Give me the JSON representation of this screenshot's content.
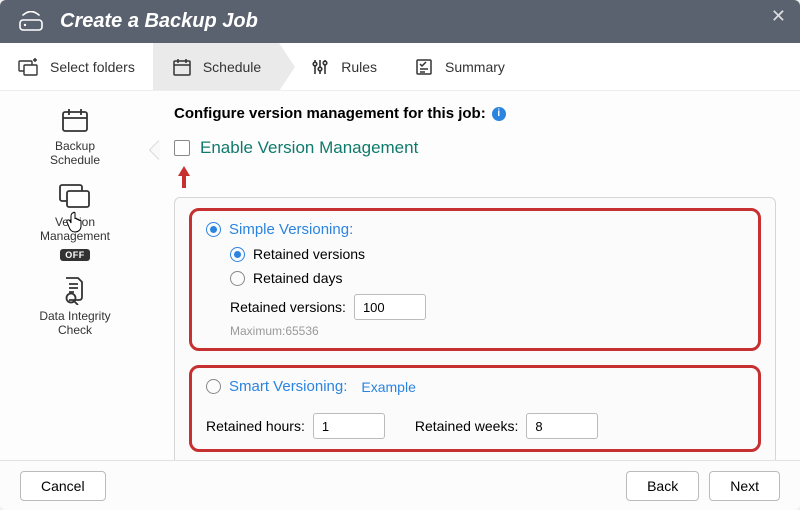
{
  "header": {
    "title": "Create a Backup Job"
  },
  "steps": {
    "select_folders": "Select folders",
    "schedule": "Schedule",
    "rules": "Rules",
    "summary": "Summary"
  },
  "sidebar": {
    "backup_schedule": "Backup\nSchedule",
    "version_mgmt": "Version\nManagement",
    "off_badge": "OFF",
    "integrity": "Data Integrity\nCheck"
  },
  "main": {
    "heading": "Configure version management for this job:",
    "enable_label": "Enable Version Management",
    "simple": {
      "title": "Simple Versioning:",
      "opt_versions": "Retained versions",
      "opt_days": "Retained days",
      "field_label": "Retained versions:",
      "value": "100",
      "max_hint": "Maximum:65536"
    },
    "smart": {
      "title": "Smart Versioning:",
      "example": "Example",
      "hours_label": "Retained hours:",
      "hours_value": "1",
      "weeks_label": "Retained weeks:",
      "weeks_value": "8"
    }
  },
  "footer": {
    "cancel": "Cancel",
    "back": "Back",
    "next": "Next"
  }
}
